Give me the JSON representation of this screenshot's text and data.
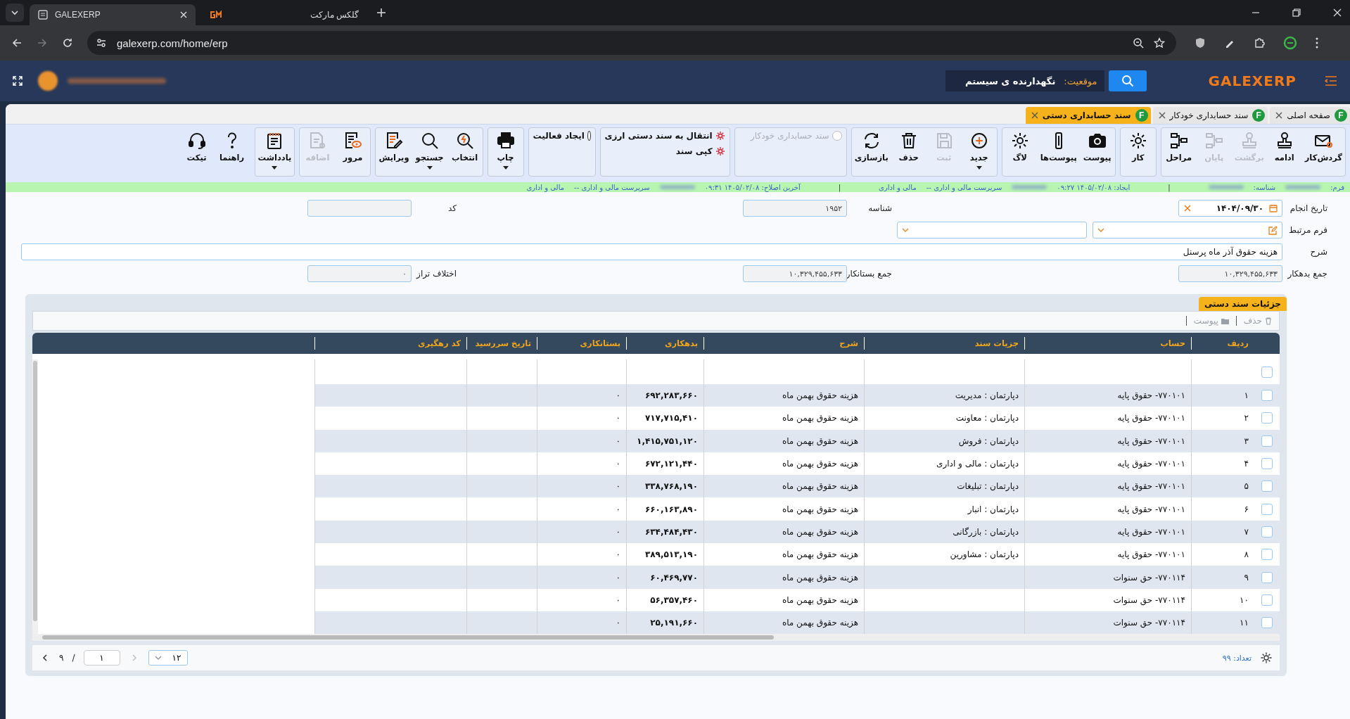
{
  "browser": {
    "tabs": [
      {
        "title": "گلکس مارکت",
        "selected": false
      },
      {
        "title": "GALEXERP",
        "selected": true
      }
    ],
    "url": "galexerp.com/home/erp"
  },
  "header": {
    "logo": "GALEXERP",
    "location_label": "موقعیت:",
    "location": "نگهدارنده ی سیستم"
  },
  "page_tabs": [
    {
      "label": "صفحه اصلی",
      "badge": "F",
      "selected": false
    },
    {
      "label": "سند حسابداری خودکار",
      "badge": "F",
      "selected": false
    },
    {
      "label": "سند حسابداری دستی",
      "badge": "F",
      "selected": true
    }
  ],
  "toolbar": [
    {
      "items": [
        {
          "kind": "button",
          "label": "گردش‌کار",
          "disabled": false
        },
        {
          "kind": "button",
          "label": "ادامه",
          "disabled": false
        },
        {
          "kind": "button",
          "label": "برگشت",
          "disabled": true
        },
        {
          "kind": "button",
          "label": "پایان",
          "disabled": true
        },
        {
          "kind": "button",
          "label": "مراحل",
          "disabled": false
        }
      ]
    },
    {
      "items": [
        {
          "kind": "button",
          "label": "کار",
          "disabled": false
        }
      ]
    },
    {
      "items": [
        {
          "kind": "button",
          "label": "پیوست",
          "disabled": false
        },
        {
          "kind": "button",
          "label": "پیوست‌ها",
          "disabled": false
        },
        {
          "kind": "button",
          "label": "لاگ",
          "disabled": false
        }
      ]
    },
    {
      "items": [
        {
          "kind": "button",
          "label": "جدید",
          "disabled": false,
          "menu": true
        },
        {
          "kind": "button",
          "label": "ثبت",
          "disabled": true
        },
        {
          "kind": "button",
          "label": "حذف",
          "disabled": false
        },
        {
          "kind": "button",
          "label": "بازسازی",
          "disabled": false
        }
      ]
    },
    {
      "items": [
        {
          "kind": "radio",
          "label": "سند حسابداری خودکار",
          "disabled": true
        }
      ]
    },
    {
      "items": [
        {
          "kind": "action",
          "label": "انتقال به سند دستی ارزی",
          "disabled": false
        },
        {
          "kind": "action",
          "label": "کپی سند",
          "disabled": false
        }
      ]
    },
    {
      "items": [
        {
          "kind": "radio",
          "label": "ایجاد فعالیت",
          "disabled": false
        }
      ]
    },
    {
      "items": [
        {
          "kind": "button",
          "label": "چاپ",
          "disabled": false,
          "menu": true
        }
      ]
    },
    {
      "items": [
        {
          "kind": "button",
          "label": "انتخاب",
          "disabled": false
        },
        {
          "kind": "button",
          "label": "جستجو",
          "disabled": false,
          "menu": true
        },
        {
          "kind": "button",
          "label": "ویرایش",
          "disabled": false
        }
      ]
    },
    {
      "items": [
        {
          "kind": "button",
          "label": "مرور",
          "disabled": false
        },
        {
          "kind": "button",
          "label": "اضافه",
          "disabled": true
        }
      ]
    },
    {
      "items": [
        {
          "kind": "button",
          "label": "یادداشت",
          "disabled": false,
          "menu": true
        }
      ]
    },
    {
      "items": [
        {
          "kind": "button",
          "label": "راهنما",
          "disabled": false
        },
        {
          "kind": "button",
          "label": "تیکت",
          "disabled": false
        }
      ]
    }
  ],
  "record_info": [
    {
      "kind": "text",
      "text": "فرم:"
    },
    {
      "kind": "redacted"
    },
    {
      "kind": "text",
      "text": "شناسه:"
    },
    {
      "kind": "redacted"
    },
    {
      "kind": "sep",
      "text": "|"
    },
    {
      "kind": "text",
      "text": "ایجاد: ۱۴۰۵/۰۲/۰۸ ۰۹:۲۷"
    },
    {
      "kind": "redacted"
    },
    {
      "kind": "text",
      "text": "سرپرست مالی و اداری --"
    },
    {
      "kind": "text",
      "text": "مالی و اداری"
    },
    {
      "kind": "sep",
      "text": "|"
    },
    {
      "kind": "text",
      "text": "آخرین اصلاح: ۱۴۰۵/۰۲/۰۸ ۰۹:۳۱"
    },
    {
      "kind": "redacted"
    },
    {
      "kind": "text",
      "text": "سرپرست مالی و اداری --"
    },
    {
      "kind": "text",
      "text": "مالی و اداری"
    }
  ],
  "form": {
    "rows": [
      [
        {
          "kind": "date",
          "label": "تاریخ انجام",
          "value": "۱۴۰۴/۰۹/۳۰"
        },
        {
          "kind": "readonly",
          "label": "شناسه",
          "value": "۱۹۵۲"
        },
        {
          "kind": "readonly",
          "label": "کد"
        }
      ],
      [
        {
          "kind": "lookup",
          "label": "فرم مرتبط"
        },
        {
          "kind": "select"
        }
      ],
      [
        {
          "kind": "memo",
          "label": "شرح",
          "value": "هزینه حقوق آذر ماه پرسنل"
        }
      ],
      [
        {
          "kind": "readonly",
          "label": "جمع بدهکار",
          "value": "۱۰,۳۲۹,۴۵۵,۶۳۳"
        },
        {
          "kind": "readonly",
          "label": "جمع بستانکار",
          "value": "۱۰,۳۲۹,۴۵۵,۶۳۳"
        },
        {
          "kind": "readonly",
          "label": "اختلاف تراز",
          "value": "۰"
        }
      ]
    ]
  },
  "details": {
    "title": "جزئیات سند دستی",
    "actions": [
      {
        "label": "حذف",
        "disabled": true
      },
      {
        "label": "پیوست",
        "disabled": true
      }
    ],
    "table": {
      "columns": [
        "ردیف",
        "حساب",
        "جزیات سند",
        "شرح",
        "بدهکاری",
        "بستانکاری",
        "تاریخ سررسید",
        "کد رهگیری"
      ],
      "rows": [
        {
          "checked": false
        },
        {
          "checked": false,
          "row": "۱",
          "account": "۷۷۰۱۰۱- حقوق پایه",
          "detail": "دپارتمان : مدیریت",
          "description": "هزینه حقوق بهمن ماه",
          "debit": "۶۹۲,۲۸۳,۶۶۰",
          "credit": "۰"
        },
        {
          "checked": false,
          "row": "۲",
          "account": "۷۷۰۱۰۱- حقوق پایه",
          "detail": "دپارتمان : معاونت",
          "description": "هزینه حقوق بهمن ماه",
          "debit": "۷۱۷,۷۱۵,۴۱۰",
          "credit": "۰"
        },
        {
          "checked": false,
          "row": "۳",
          "account": "۷۷۰۱۰۱- حقوق پایه",
          "detail": "دپارتمان : فروش",
          "description": "هزینه حقوق بهمن ماه",
          "debit": "۱,۴۱۵,۷۵۱,۱۲۰",
          "credit": "۰"
        },
        {
          "checked": false,
          "row": "۴",
          "account": "۷۷۰۱۰۱- حقوق پایه",
          "detail": "دپارتمان : مالی و اداری",
          "description": "هزینه حقوق بهمن ماه",
          "debit": "۶۷۲,۱۲۱,۴۴۰",
          "credit": "۰"
        },
        {
          "checked": false,
          "row": "۵",
          "account": "۷۷۰۱۰۱- حقوق پایه",
          "detail": "دپارتمان : تبلیغات",
          "description": "هزینه حقوق بهمن ماه",
          "debit": "۳۳۸,۷۶۸,۱۹۰",
          "credit": "۰"
        },
        {
          "checked": false,
          "row": "۶",
          "account": "۷۷۰۱۰۱- حقوق پایه",
          "detail": "دپارتمان : انبار",
          "description": "هزینه حقوق بهمن ماه",
          "debit": "۶۶۰,۱۶۳,۸۹۰",
          "credit": "۰"
        },
        {
          "checked": false,
          "row": "۷",
          "account": "۷۷۰۱۰۱- حقوق پایه",
          "detail": "دپارتمان : بازرگانی",
          "description": "هزینه حقوق بهمن ماه",
          "debit": "۶۳۴,۴۸۴,۴۳۰",
          "credit": "۰"
        },
        {
          "checked": false,
          "row": "۸",
          "account": "۷۷۰۱۰۱- حقوق پایه",
          "detail": "دپارتمان : مشاورین",
          "description": "هزینه حقوق بهمن ماه",
          "debit": "۳۸۹,۵۱۳,۱۹۰",
          "credit": "۰"
        },
        {
          "checked": false,
          "row": "۹",
          "account": "۷۷۰۱۱۴- حق سنوات",
          "description": "هزینه حقوق بهمن ماه",
          "debit": "۶۰,۴۶۹,۷۷۰",
          "credit": "۰"
        },
        {
          "checked": false,
          "row": "۱۰",
          "account": "۷۷۰۱۱۴- حق سنوات",
          "description": "هزینه حقوق بهمن ماه",
          "debit": "۵۶,۳۵۷,۴۶۰",
          "credit": "۰"
        },
        {
          "checked": false,
          "row": "۱۱",
          "account": "۷۷۰۱۱۴- حق سنوات",
          "description": "هزینه حقوق بهمن ماه",
          "debit": "۲۵,۱۹۱,۶۶۰",
          "credit": "۰"
        }
      ]
    },
    "footer": {
      "count": "تعداد: ۹۹",
      "page_size": "۱۲",
      "page": "۱",
      "separator": "/",
      "total_pages": "۹"
    }
  }
}
